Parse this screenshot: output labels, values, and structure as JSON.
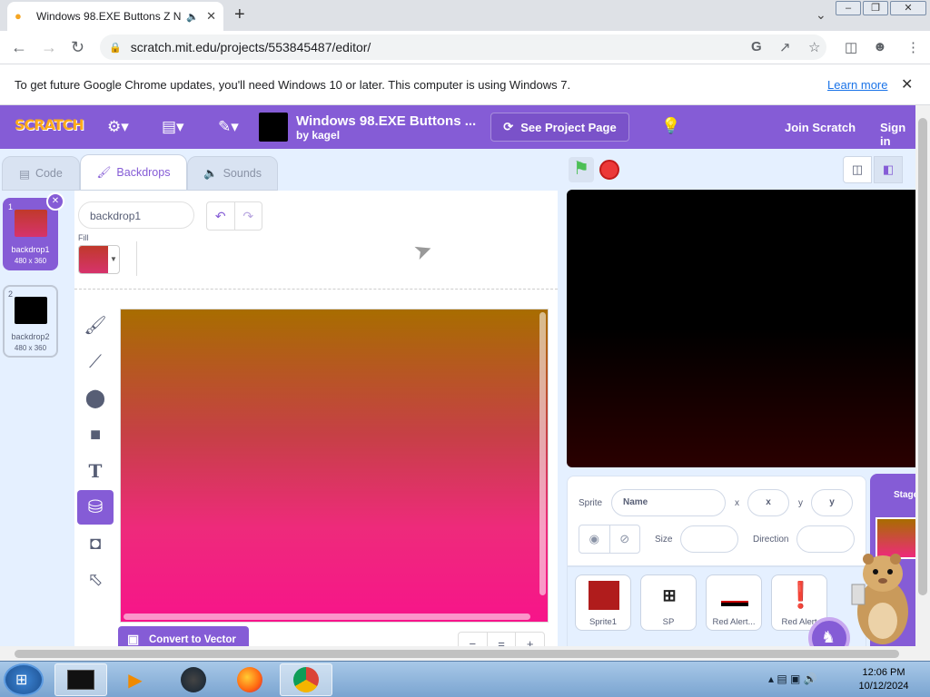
{
  "browser": {
    "tab_title": "Windows 98.EXE Buttons Z N",
    "url": "scratch.mit.edu/projects/553845487/editor/",
    "info_message": "To get future Google Chrome updates, you'll need Windows 10 or later. This computer is using Windows 7.",
    "learn_more": "Learn more"
  },
  "menubar": {
    "logo": "SCRATCH",
    "project_title": "Windows 98.EXE Buttons ...",
    "project_by": "by kagel",
    "see_project": "See Project Page",
    "join": "Join Scratch",
    "sign_in": "Sign in"
  },
  "tabs": {
    "code": "Code",
    "backdrops": "Backdrops",
    "sounds": "Sounds"
  },
  "backdrops": [
    {
      "num": "1",
      "name": "backdrop1",
      "size": "480 x 360",
      "color": "#d6336c"
    },
    {
      "num": "2",
      "name": "backdrop2",
      "size": "480 x 360",
      "color": "#000000"
    }
  ],
  "paint": {
    "backdrop_name": "backdrop1",
    "fill_label": "Fill",
    "convert_label": "Convert to Vector",
    "zoom_out": "−",
    "zoom_reset": "=",
    "zoom_in": "+"
  },
  "sprite_info": {
    "sprite_label": "Sprite",
    "name_placeholder": "Name",
    "x_label": "x",
    "x_placeholder": "x",
    "y_label": "y",
    "y_placeholder": "y",
    "size_label": "Size",
    "direction_label": "Direction"
  },
  "sprites": [
    {
      "name": "Sprite1",
      "thumb": "#b01c1c"
    },
    {
      "name": "SP",
      "thumb": "#ffffff"
    },
    {
      "name": "Red Alert...",
      "thumb": "#ffffff"
    },
    {
      "name": "Red Alert",
      "thumb": "#ffffff"
    }
  ],
  "stage_panel": {
    "label": "Stage"
  },
  "taskbar": {
    "time": "12:06 PM",
    "date": "10/12/2024"
  },
  "colors": {
    "scratch_purple": "#855cd6",
    "stop_red": "#ec3838",
    "flag_green": "#4cbf56"
  }
}
